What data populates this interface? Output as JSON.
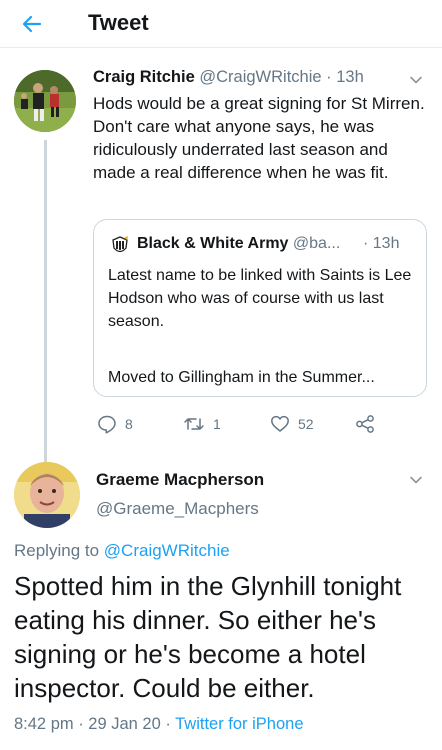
{
  "header": {
    "title": "Tweet"
  },
  "tweet": {
    "author_name": "Craig Ritchie",
    "author_handle": "@CraigWRitchie",
    "separator": "·",
    "time": "13h",
    "text": "Hods would be a great signing for St Mirren. Don't care what anyone says, he was ridiculously underrated last season and made a real difference when he was fit.",
    "quoted": {
      "author_name": "Black & White Army",
      "author_handle": "@ba...",
      "time": "· 13h",
      "text": "Latest name to be linked with Saints is Lee Hodson who was of course with us last season.",
      "text_more": "Moved to Gillingham in the Summer..."
    },
    "actions": {
      "replies": "8",
      "retweets": "1",
      "likes": "52"
    }
  },
  "reply": {
    "author_name": "Graeme Macpherson",
    "author_handle": "@Graeme_Macphers",
    "replying_prefix": "Replying to",
    "replying_handle": "@CraigWRitchie",
    "text": "Spotted him in the Glynhill tonight eating his dinner. So either he's signing or he's become a hotel inspector. Could be either.",
    "timestamp": "8:42 pm · 29 Jan 20 · ",
    "source": "Twitter for iPhone"
  },
  "colors": {
    "accent": "#1da1f2",
    "secondary_text": "#657786",
    "primary_text": "#14171a",
    "border": "#ccd6dd"
  },
  "icons": {
    "back": "arrow-left-icon",
    "caret": "chevron-down-icon",
    "reply": "reply-icon",
    "retweet": "retweet-icon",
    "like": "heart-icon",
    "share": "share-icon"
  }
}
